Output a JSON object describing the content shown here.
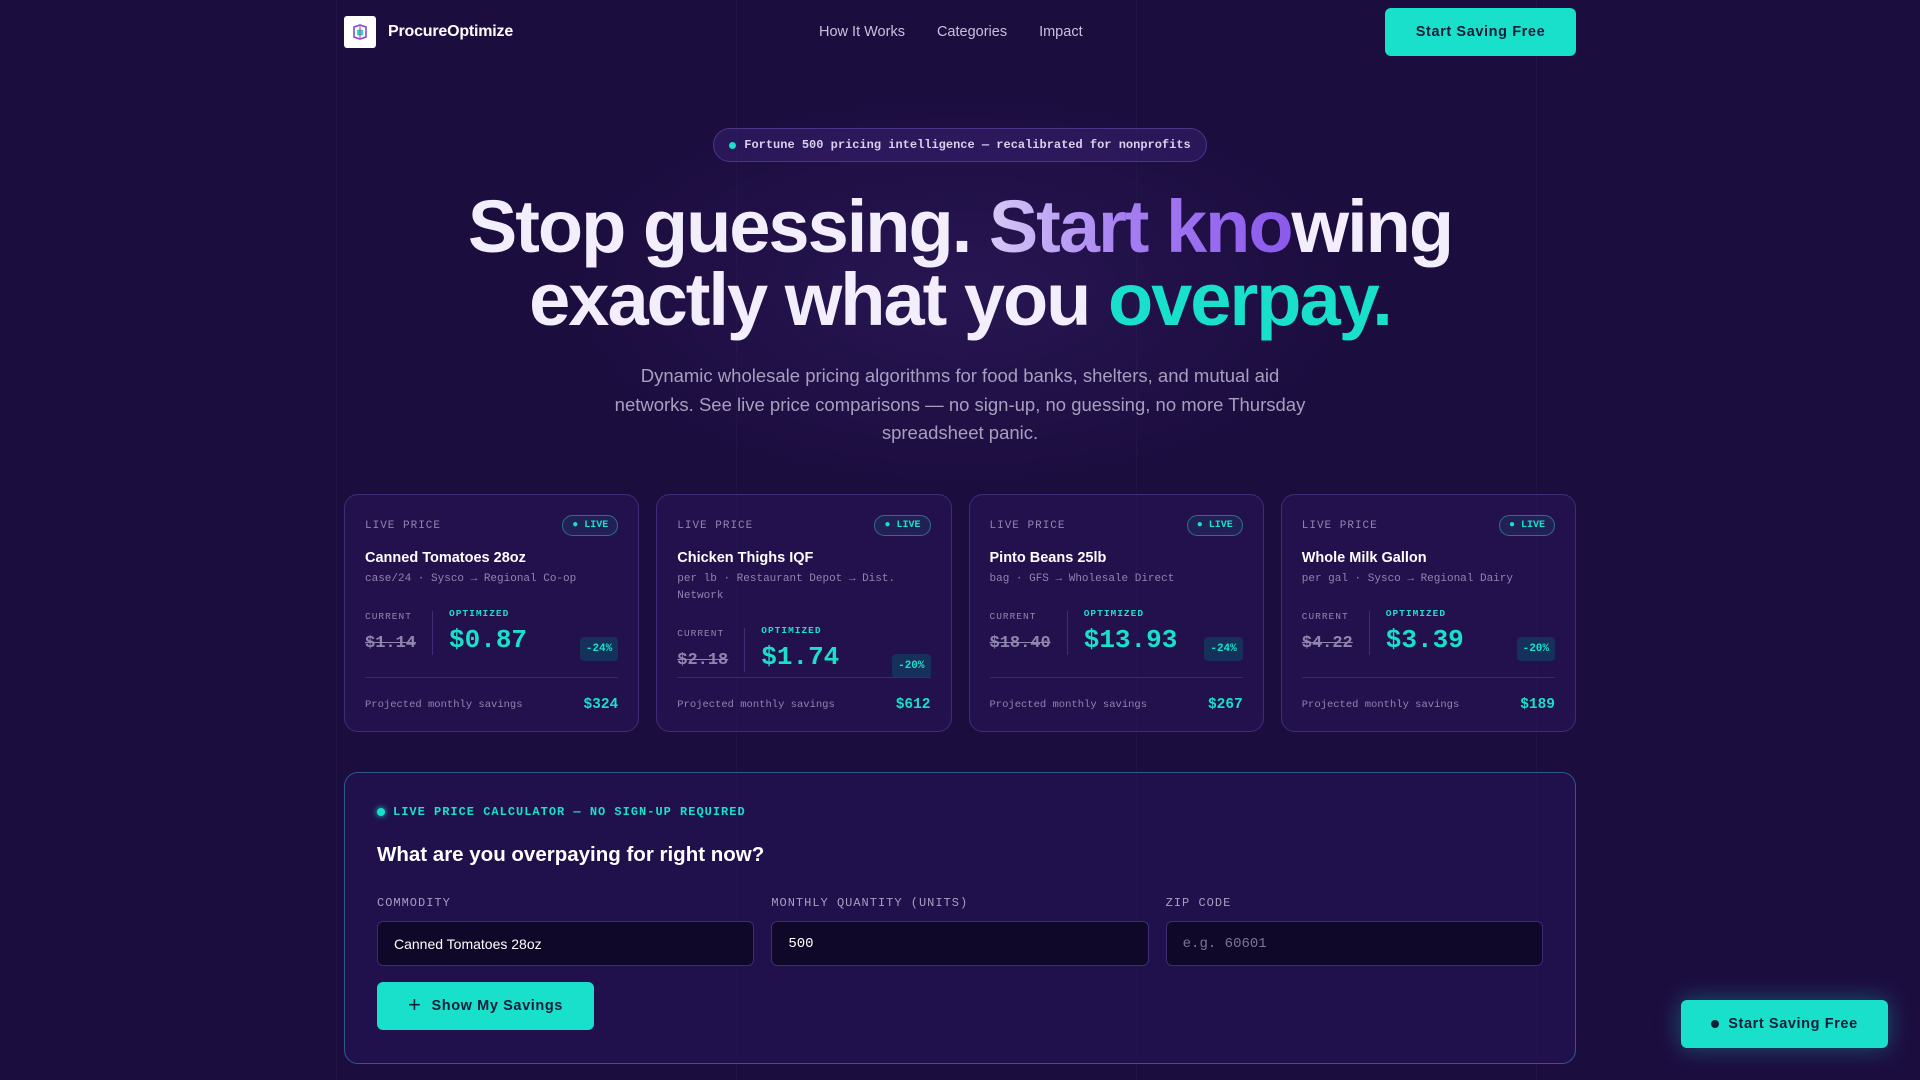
{
  "brand": {
    "name": "ProcureOptimize"
  },
  "nav": {
    "links": [
      "How It Works",
      "Categories",
      "Impact"
    ],
    "cta": "Start Saving Free"
  },
  "hero": {
    "pill": "Fortune 500 pricing intelligence — recalibrated for nonprofits",
    "headline_part1": "Stop guessing. ",
    "headline_part2": "Start kno",
    "headline_part3": "wing",
    "headline_part4": "exactly what you ",
    "headline_part5": "overpay.",
    "subhead": "Dynamic wholesale pricing algorithms for food banks, shelters, and mutual aid networks. See live price comparisons — no sign-up, no guessing, no more Thursday spreadsheet panic."
  },
  "cards": [
    {
      "eyebrow": "LIVE PRICE",
      "badge": "● LIVE",
      "title": "Canned Tomatoes 28oz",
      "meta": "case/24 · Sysco → Regional Co-op",
      "current_label": "CURRENT",
      "optimized_label": "OPTIMIZED",
      "current": "$1.14",
      "optimized": "$0.87",
      "pct": "-24%",
      "foot_label": "Projected monthly savings",
      "savings": "$324"
    },
    {
      "eyebrow": "LIVE PRICE",
      "badge": "● LIVE",
      "title": "Chicken Thighs IQF",
      "meta": "per lb · Restaurant Depot → Dist. Network",
      "current_label": "CURRENT",
      "optimized_label": "OPTIMIZED",
      "current": "$2.18",
      "optimized": "$1.74",
      "pct": "-20%",
      "foot_label": "Projected monthly savings",
      "savings": "$612"
    },
    {
      "eyebrow": "LIVE PRICE",
      "badge": "● LIVE",
      "title": "Pinto Beans 25lb",
      "meta": "bag · GFS → Wholesale Direct",
      "current_label": "CURRENT",
      "optimized_label": "OPTIMIZED",
      "current": "$18.40",
      "optimized": "$13.93",
      "pct": "-24%",
      "foot_label": "Projected monthly savings",
      "savings": "$267"
    },
    {
      "eyebrow": "LIVE PRICE",
      "badge": "● LIVE",
      "title": "Whole Milk Gallon",
      "meta": "per gal · Sysco → Regional Dairy",
      "current_label": "CURRENT",
      "optimized_label": "OPTIMIZED",
      "current": "$4.22",
      "optimized": "$3.39",
      "pct": "-20%",
      "foot_label": "Projected monthly savings",
      "savings": "$189"
    }
  ],
  "calculator": {
    "eyebrow": "LIVE PRICE CALCULATOR — NO SIGN-UP REQUIRED",
    "title": "What are you overpaying for right now?",
    "fields": [
      {
        "label": "COMMODITY",
        "value": "Canned Tomatoes 28oz",
        "placeholder": ""
      },
      {
        "label": "MONTHLY QUANTITY (UNITS)",
        "value": "500",
        "placeholder": ""
      },
      {
        "label": "ZIP CODE",
        "value": "",
        "placeholder": "e.g. 60601"
      }
    ],
    "button": "Show My Savings"
  },
  "floating_cta": "Start Saving Free",
  "colors": {
    "accent": "#19e0cb",
    "background": "#1c0d3f",
    "purple": "#8b59ec"
  }
}
